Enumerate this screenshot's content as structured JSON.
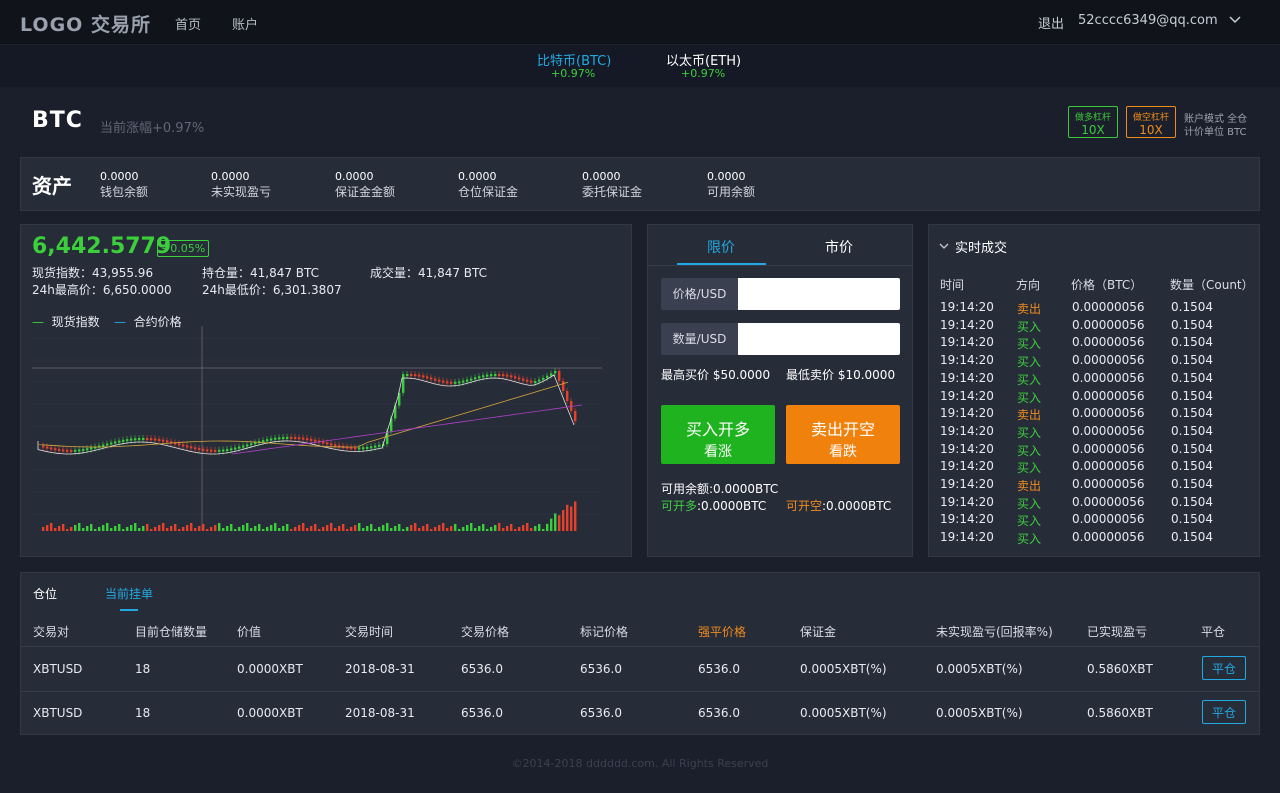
{
  "nav": {
    "logo": "LOGO 交易所",
    "links": [
      "首页",
      "账户"
    ],
    "logout": "退出",
    "email": "52cccc6349@qq.com"
  },
  "tickers": [
    {
      "name": "比特币(BTC)",
      "change": "+0.97%",
      "color": "#22a8e0"
    },
    {
      "name": "以太币(ETH)",
      "change": "+0.97%",
      "color": "#ffffff"
    }
  ],
  "header": {
    "symbol": "BTC",
    "change_label": "当前涨幅+0.97%",
    "long_lev": {
      "label": "做多杠杆",
      "value": "10X"
    },
    "short_lev": {
      "label": "做空杠杆",
      "value": "10X"
    },
    "mode": "账户模式 全仓",
    "unit": "计价单位 BTC"
  },
  "assets": {
    "title": "资产",
    "items": [
      {
        "value": "0.0000",
        "label": "钱包余额"
      },
      {
        "value": "0.0000",
        "label": "未实现盈亏"
      },
      {
        "value": "0.0000",
        "label": "保证金金额"
      },
      {
        "value": "0.0000",
        "label": "仓位保证金"
      },
      {
        "value": "0.0000",
        "label": "委托保证金"
      },
      {
        "value": "0.0000",
        "label": "可用余额"
      }
    ]
  },
  "market": {
    "price": "6,442.5779",
    "price_change": "+0.05%",
    "spot_index": "现货指数：43,955.96",
    "open_interest": "持仓量：41,847 BTC",
    "volume": "成交量：41,847 BTC",
    "high24": "24h最高价：6,650.0000",
    "low24": "24h最低价：6,301.3807",
    "legend": [
      "现货指数",
      "合约价格"
    ]
  },
  "order": {
    "tabs": [
      "限价",
      "市价"
    ],
    "price_label": "价格/USD",
    "qty_label": "数量/USD",
    "price_value": "",
    "qty_value": "",
    "best_bid": "最高买价 $50.0000",
    "best_ask": "最低卖价 $10.0000",
    "buy_line1": "买入开多",
    "buy_line2": "看涨",
    "sell_line1": "卖出开空",
    "sell_line2": "看跌",
    "available": "可用余额:0.0000BTC",
    "can_long_label": "可开多",
    "can_long_value": ":0.0000BTC",
    "can_short_label": "可开空",
    "can_short_value": ":0.0000BTC"
  },
  "trades": {
    "title": "实时成交",
    "headers": [
      "时间",
      "方向",
      "价格（BTC）",
      "数量（Count）"
    ],
    "rows": [
      {
        "time": "19:14:20",
        "side": "卖出",
        "price": "0.00000056",
        "qty": "0.1504"
      },
      {
        "time": "19:14:20",
        "side": "买入",
        "price": "0.00000056",
        "qty": "0.1504"
      },
      {
        "time": "19:14:20",
        "side": "买入",
        "price": "0.00000056",
        "qty": "0.1504"
      },
      {
        "time": "19:14:20",
        "side": "买入",
        "price": "0.00000056",
        "qty": "0.1504"
      },
      {
        "time": "19:14:20",
        "side": "买入",
        "price": "0.00000056",
        "qty": "0.1504"
      },
      {
        "time": "19:14:20",
        "side": "买入",
        "price": "0.00000056",
        "qty": "0.1504"
      },
      {
        "time": "19:14:20",
        "side": "卖出",
        "price": "0.00000056",
        "qty": "0.1504"
      },
      {
        "time": "19:14:20",
        "side": "买入",
        "price": "0.00000056",
        "qty": "0.1504"
      },
      {
        "time": "19:14:20",
        "side": "买入",
        "price": "0.00000056",
        "qty": "0.1504"
      },
      {
        "time": "19:14:20",
        "side": "买入",
        "price": "0.00000056",
        "qty": "0.1504"
      },
      {
        "time": "19:14:20",
        "side": "卖出",
        "price": "0.00000056",
        "qty": "0.1504"
      },
      {
        "time": "19:14:20",
        "side": "买入",
        "price": "0.00000056",
        "qty": "0.1504"
      },
      {
        "time": "19:14:20",
        "side": "买入",
        "price": "0.00000056",
        "qty": "0.1504"
      },
      {
        "time": "19:14:20",
        "side": "买入",
        "price": "0.00000056",
        "qty": "0.1504"
      }
    ]
  },
  "positions": {
    "tabs": [
      "仓位",
      "当前挂单"
    ],
    "headers": [
      "交易对",
      "目前仓储数量",
      "价值",
      "交易时间",
      "交易价格",
      "标记价格",
      "强平价格",
      "保证金",
      "未实现盈亏(回报率%)",
      "已实现盈亏",
      "平仓"
    ],
    "rows": [
      [
        "XBTUSD",
        "18",
        "0.0000XBT",
        "2018-08-31",
        "6536.0",
        "6536.0",
        "6536.0",
        "0.0005XBT(%)",
        "0.0005XBT(%)",
        "0.5860XBT"
      ],
      [
        "XBTUSD",
        "18",
        "0.0000XBT",
        "2018-08-31",
        "6536.0",
        "6536.0",
        "6536.0",
        "0.0005XBT(%)",
        "0.0005XBT(%)",
        "0.5860XBT"
      ]
    ],
    "close_label": "平仓"
  },
  "footer": "©2014-2018 dddddd.com. All Rights Reserved",
  "colors": {
    "accent": "#22a8e0",
    "up": "#3ccf3c",
    "down": "#f08b1c"
  }
}
